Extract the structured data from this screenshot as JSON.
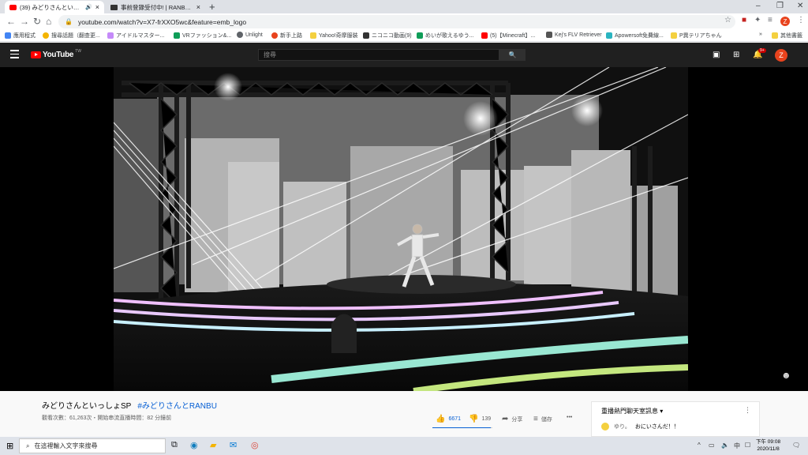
{
  "browser": {
    "tabs": [
      {
        "title": "(39) みどりさんといっしょSP",
        "active": true
      },
      {
        "title": "事前登錄受付中! | RANBU 三国",
        "active": false
      }
    ],
    "new_tab": "+",
    "window_controls": {
      "minimize": "–",
      "restore": "❐",
      "close": "✕"
    },
    "url": "youtube.com/watch?v=X7-frXXO5wc&feature=emb_logo",
    "profile_initial": "Z",
    "bookmarks": [
      {
        "label": "應用程式",
        "icon_color": "#4285f4"
      },
      {
        "label": "搜尋話題（翻查更...",
        "icon_color": "#f4b400"
      },
      {
        "label": "アイドルマスター...",
        "icon_color": "#db4437"
      },
      {
        "label": "VRファッション&...",
        "icon_color": "#0f9d58"
      },
      {
        "label": "Unlight",
        "icon_color": "#5f6368"
      },
      {
        "label": "新手上路",
        "icon_color": "#e8431d"
      },
      {
        "label": "Yahoo!奇摩服裝",
        "icon_color": "#7b0099"
      },
      {
        "label": "ニコニコ動画(9)",
        "icon_color": "#333333"
      },
      {
        "label": "めいが歌えるゆう...",
        "icon_color": "#0f9d58"
      },
      {
        "label": "(5)【Minecraft】...",
        "icon_color": "#ff0000"
      },
      {
        "label": "Kej's FLV Retriever",
        "icon_color": "#555555"
      },
      {
        "label": "Apowersoft免費線...",
        "icon_color": "#2ab4c0"
      },
      {
        "label": "P異テリアちゃん",
        "icon_color": "#f4b400"
      },
      {
        "label": "其他書籤",
        "icon_color": "#f4b400"
      }
    ],
    "bookmarks_overflow": "»"
  },
  "youtube": {
    "logo_text": "YouTube",
    "logo_region": "TW",
    "search_placeholder": "搜尋",
    "search_icon": "🔍",
    "notification_count": "9+",
    "avatar_initial": "Z"
  },
  "video": {
    "title": "みどりさんといっしょSP",
    "hashtag": "#みどりさんとRANBU",
    "meta": "觀看次數：61,263次・開始串流直播時間：82 分鐘前",
    "likes": "6671",
    "dislikes": "139",
    "like_ratio": 0.98,
    "share_label": "分享",
    "save_label": "儲存",
    "more_label": "•••"
  },
  "chat": {
    "title": "重播熱門聊天室訊息",
    "messages": [
      {
        "author": "ゆり。",
        "text": "おにいさんだ！！"
      }
    ]
  },
  "taskbar": {
    "search_placeholder": "在這裡輸入文字來搜尋",
    "time": "下午 09:08",
    "date": "2020/11/8"
  }
}
